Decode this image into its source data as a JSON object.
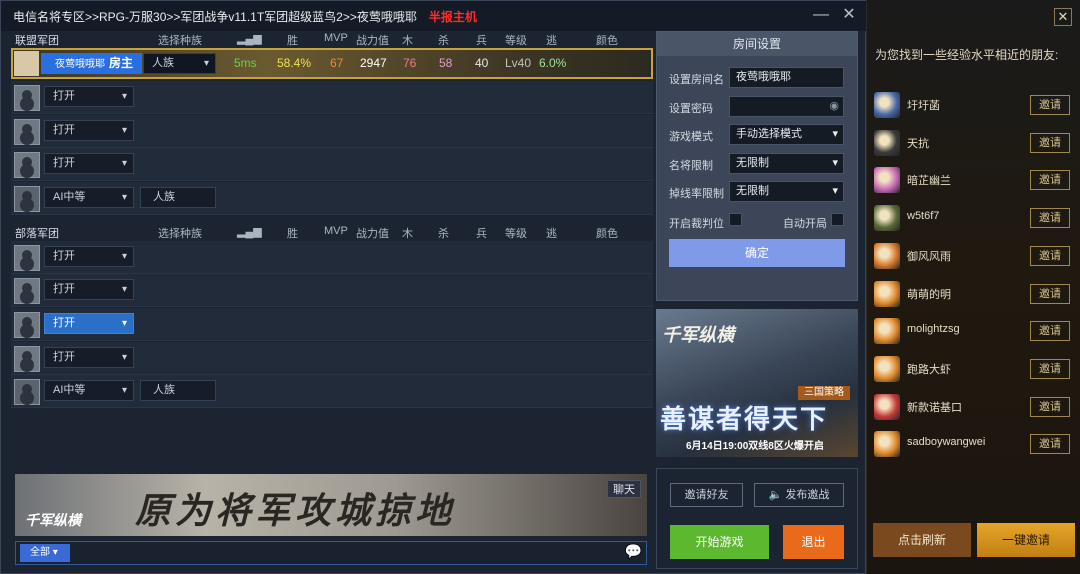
{
  "title": "电信名将专区>>RPG-万服30>>军团战争v11.1T军团超级蓝鸟2>>夜莺哦哦耶",
  "title_tag": "半报主机",
  "columns": {
    "race": "选择种族",
    "signal": "",
    "win": "胜",
    "mvp": "MVP",
    "power": "战力值",
    "wood": "木",
    "kill": "杀",
    "soldier": "兵",
    "level": "等级",
    "escape": "逃",
    "color": "颜色"
  },
  "team1": {
    "name": "联盟军团"
  },
  "team2": {
    "name": "部落军团"
  },
  "host": {
    "name": "夜莺哦哦耶",
    "role": "房主",
    "race": "人族",
    "ping": "5ms",
    "winrate": "58.4%",
    "mvp": "67",
    "power": "2947",
    "wood": "76",
    "kill": "58",
    "soldier": "40",
    "level": "Lv40",
    "escape": "6.0%"
  },
  "slots": {
    "open": "打开",
    "ai": "AI中等",
    "ai_race": "人族"
  },
  "room": {
    "header": "房间设置",
    "name_label": "设置房间名",
    "name_value": "夜莺哦哦耶",
    "pwd_label": "设置密码",
    "mode_label": "游戏模式",
    "mode_value": "手动选择模式",
    "hero_label": "名将限制",
    "hero_value": "无限制",
    "drop_label": "掉线率限制",
    "drop_value": "无限制",
    "judge_label": "开启裁判位",
    "auto_label": "自动开局",
    "ok": "确定"
  },
  "ad_right": {
    "logo": "千军纵横",
    "tag": "三国策略",
    "big": "善谋者得天下",
    "date": "6月14日19:00双线8区火爆开启"
  },
  "ad_bottom": {
    "title": "原为将军攻城掠地",
    "logo": "千军纵横"
  },
  "chat": {
    "button": "聊天",
    "filter": "全部"
  },
  "actions": {
    "invite": "邀请好友",
    "publish": "发布邀战",
    "start": "开始游戏",
    "quit": "退出"
  },
  "side": {
    "hint": "为您找到一些经验水平相近的朋友:",
    "invite": "邀请",
    "friends": [
      {
        "name": "圩圩菡",
        "color": "#4a6aa8"
      },
      {
        "name": "天抗",
        "color": "#3a3a3a"
      },
      {
        "name": "暗芷幽兰",
        "color": "#c86ab8"
      },
      {
        "name": "w5t6f7",
        "color": "#5a6a3a"
      },
      {
        "name": "御风风雨",
        "color": "#d87a2a"
      },
      {
        "name": "萌萌的明",
        "color": "#e08a2a"
      },
      {
        "name": "molightzsg",
        "color": "#e08a2a"
      },
      {
        "name": "跑路大虾",
        "color": "#e08a2a"
      },
      {
        "name": "新款诺基口",
        "color": "#c83a3a"
      },
      {
        "name": "sadboywangwei",
        "color": "#e08a2a"
      }
    ],
    "refresh": "点击刷新",
    "invite_all": "一键邀请"
  }
}
